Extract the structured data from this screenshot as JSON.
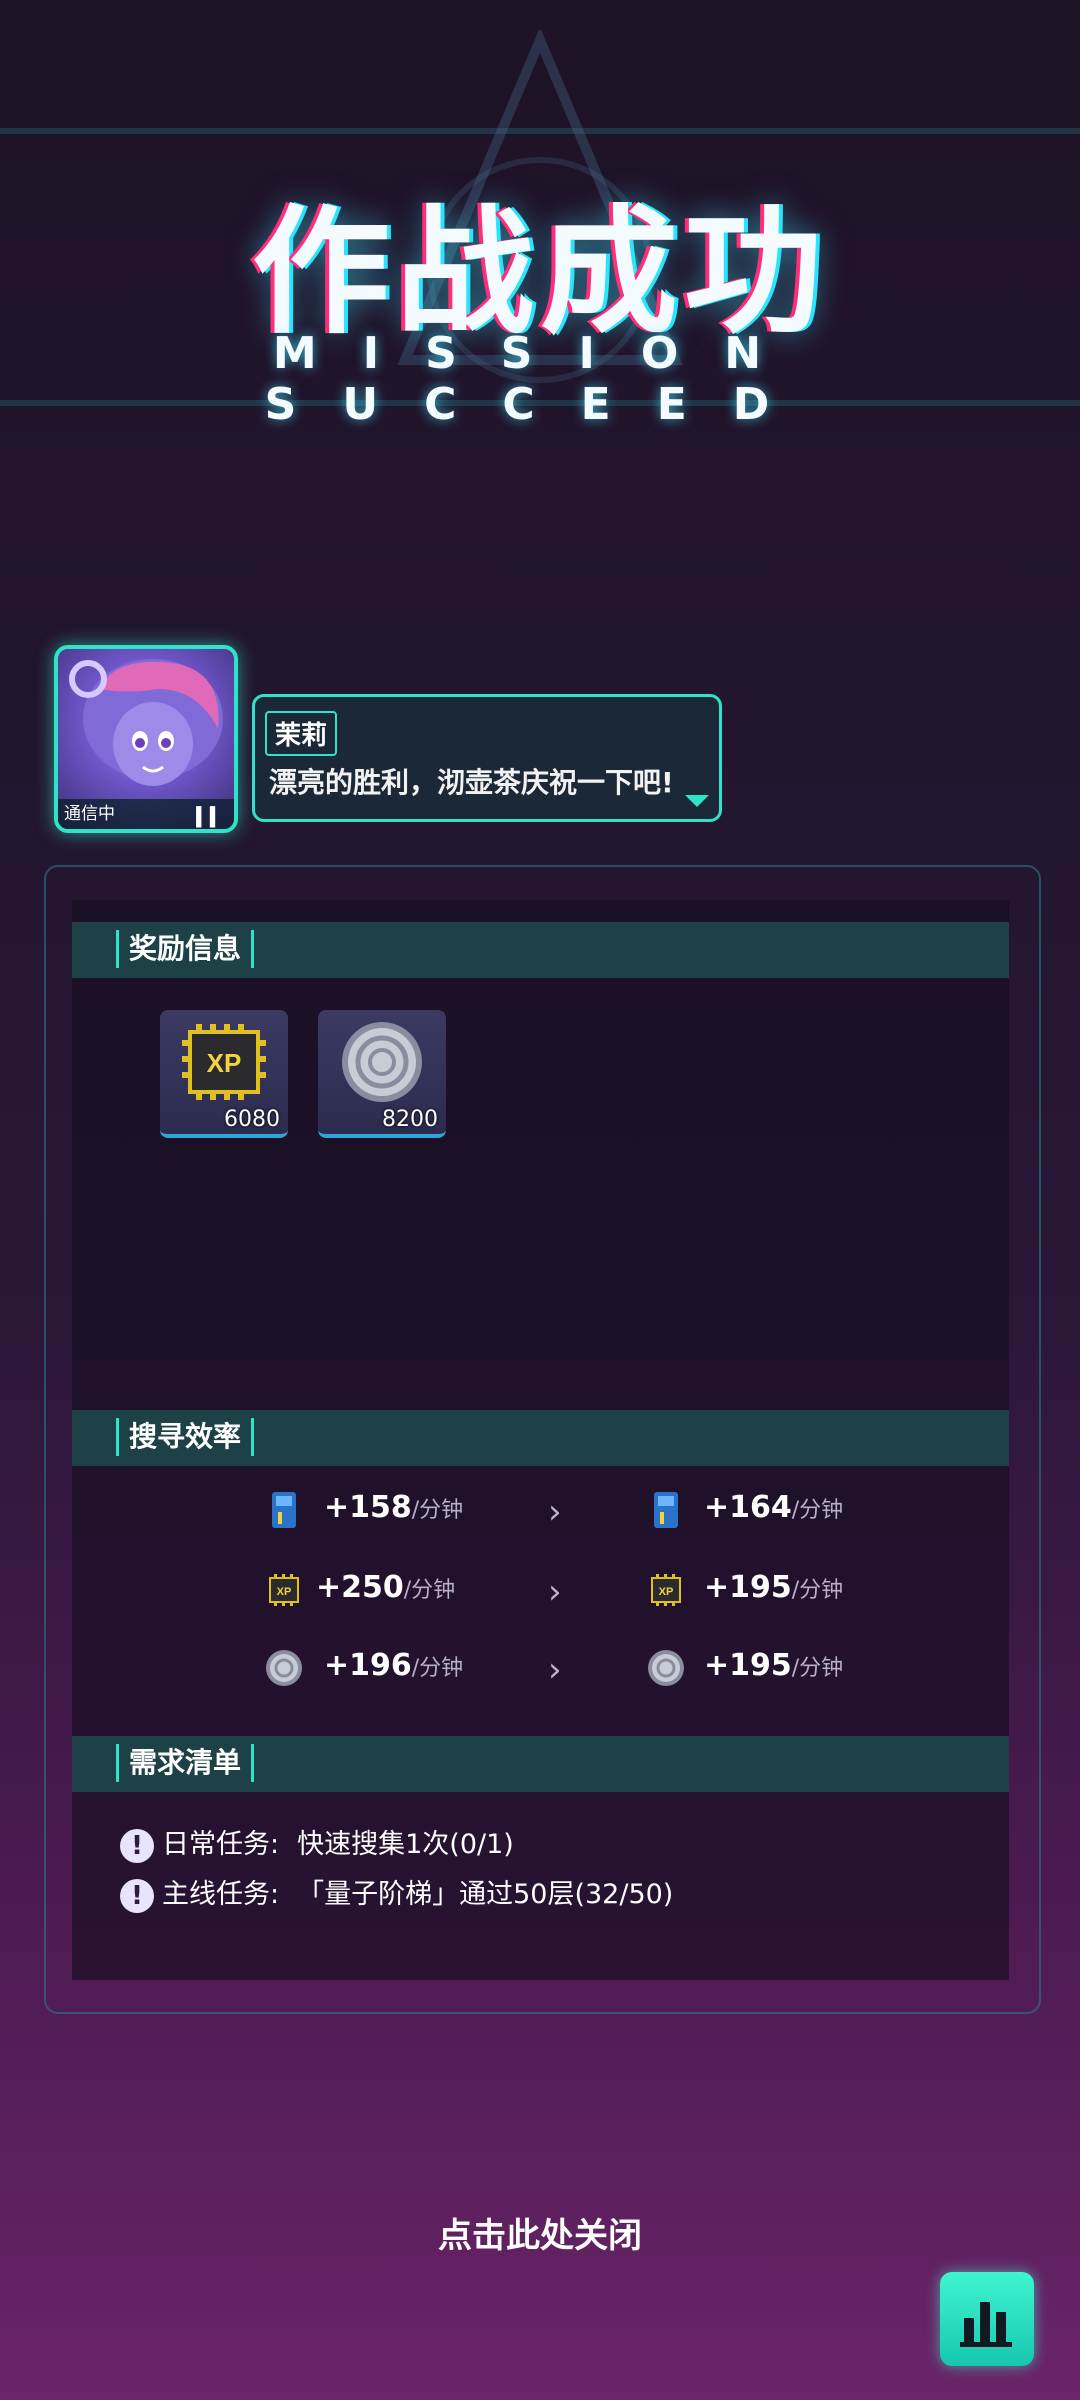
{
  "header": {
    "title_cn": "作战成功",
    "title_en": "MISSION SUCCEED"
  },
  "dialog": {
    "portrait_status": "通信中",
    "speaker": "茉莉",
    "text": "漂亮的胜利，沏壶茶庆祝一下吧!"
  },
  "rewards": {
    "title": "奖励信息",
    "items": [
      {
        "icon": "xp-chip-icon",
        "count": "6080"
      },
      {
        "icon": "silver-coin-icon",
        "count": "8200"
      }
    ]
  },
  "efficiency": {
    "title": "搜寻效率",
    "unit": "/分钟",
    "rows": [
      {
        "icon": "blue-card-icon",
        "before": "+158",
        "after": "+164"
      },
      {
        "icon": "xp-chip-icon",
        "before": "+250",
        "after": "+195"
      },
      {
        "icon": "silver-coin-icon",
        "before": "+196",
        "after": "+195"
      }
    ]
  },
  "requirements": {
    "title": "需求清单",
    "items": [
      {
        "label": "日常任务:",
        "text": "快速搜集1次(0/1)"
      },
      {
        "label": "主线任务:",
        "text": "「量子阶梯」通过50层(32/50)"
      }
    ]
  },
  "footer": {
    "close_text": "点击此处关闭",
    "stats_icon": "bar-chart-icon"
  },
  "colors": {
    "accent": "#2fe3c8",
    "section_bar": "#1d4147",
    "bg_top": "#1e1226",
    "bg_bottom": "#6a2468"
  }
}
